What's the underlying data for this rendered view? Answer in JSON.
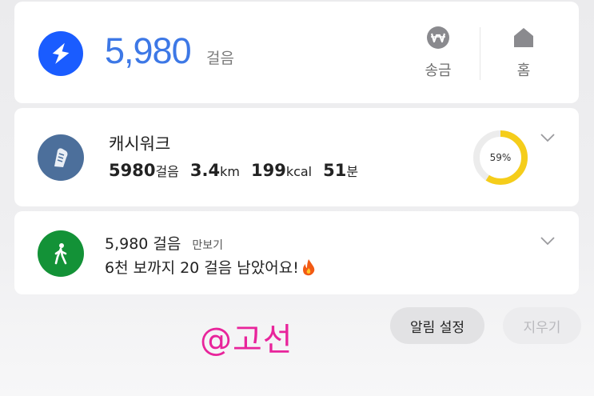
{
  "summary": {
    "steps": "5,980",
    "unit": "걸음",
    "actions": [
      {
        "label": "송금",
        "icon": "won-coin-icon"
      },
      {
        "label": "홈",
        "icon": "home-icon"
      }
    ]
  },
  "cashwalk": {
    "title": "캐시워크",
    "stats": [
      {
        "value": "5980",
        "unit": "걸음"
      },
      {
        "value": "3.4",
        "unit": "km"
      },
      {
        "value": "199",
        "unit": "kcal"
      },
      {
        "value": "51",
        "unit": "분"
      }
    ],
    "progress_label": "59%",
    "progress": 0.59,
    "colors": {
      "ring": "#f5cd1a",
      "track": "#ececec",
      "icon_bg": "#4c6f9b"
    }
  },
  "pedometer": {
    "steps": "5,980 걸음",
    "app": "만보기",
    "message": "6천 보까지 20 걸음 남았어요!",
    "emoji_icon": "fire-icon"
  },
  "watermark": "@고선",
  "buttons": {
    "alarm_settings": "알림 설정",
    "clear": "지우기"
  }
}
